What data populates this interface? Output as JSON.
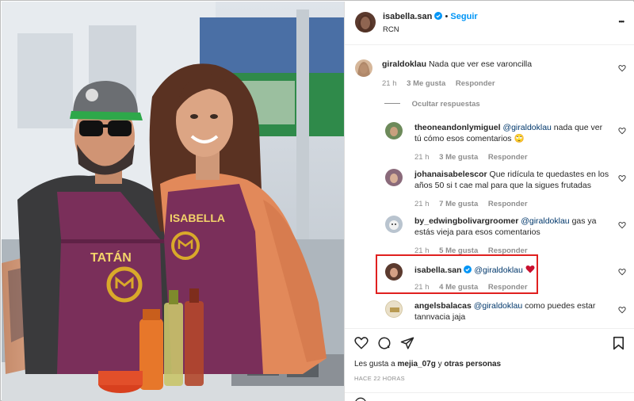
{
  "post": {
    "username": "isabella.san",
    "follow_label": "Seguir",
    "location": "RCN",
    "more_label": "•••"
  },
  "photo": {
    "apron_left_name": "TATÁN",
    "apron_right_name": "ISABELLA"
  },
  "comments": [
    {
      "user": "giraldoklau",
      "text": "Nada que ver ese varoncilla",
      "time": "21 h",
      "likes": "3 Me gusta",
      "reply": "Responder"
    },
    {
      "hide_replies": "Ocultar respuestas"
    }
  ],
  "replies": [
    {
      "user": "theoneandonlymiguel",
      "mention": "@giraldoklau",
      "text": " nada que ver tú cómo esos comentarios 🙄",
      "time": "21 h",
      "likes": "3 Me gusta",
      "reply": "Responder"
    },
    {
      "user": "johanaisabelescor",
      "text": "Que ridícula te quedastes en los años 50 si t cae mal para que la sigues frutadas",
      "time": "21 h",
      "likes": "7 Me gusta",
      "reply": "Responder"
    },
    {
      "user": "by_edwingbolivargroomer",
      "mention": "@giraldoklau",
      "text": " gas ya estás vieja para esos comentarios",
      "time": "21 h",
      "likes": "5 Me gusta",
      "reply": "Responder"
    },
    {
      "user": "isabella.san",
      "mention": "@giraldoklau",
      "text": "",
      "time": "21 h",
      "likes": "4 Me gusta",
      "reply": "Responder"
    },
    {
      "user": "angelsbalacas",
      "mention": "@giraldoklau",
      "text": " como puedes estar tannvacia jaja"
    }
  ],
  "footer": {
    "likes_text_prefix": "Les gusta a ",
    "likes_user": "mejia_07g",
    "likes_text_suffix": " y ",
    "likes_others": "otras personas",
    "timestamp": "HACE 22 HORAS"
  },
  "colors": {
    "accent": "#0095f6",
    "highlight": "#e0201f",
    "heart": "#ed4956",
    "apron": "#7a2f5a",
    "logo": "#d9a92a"
  }
}
